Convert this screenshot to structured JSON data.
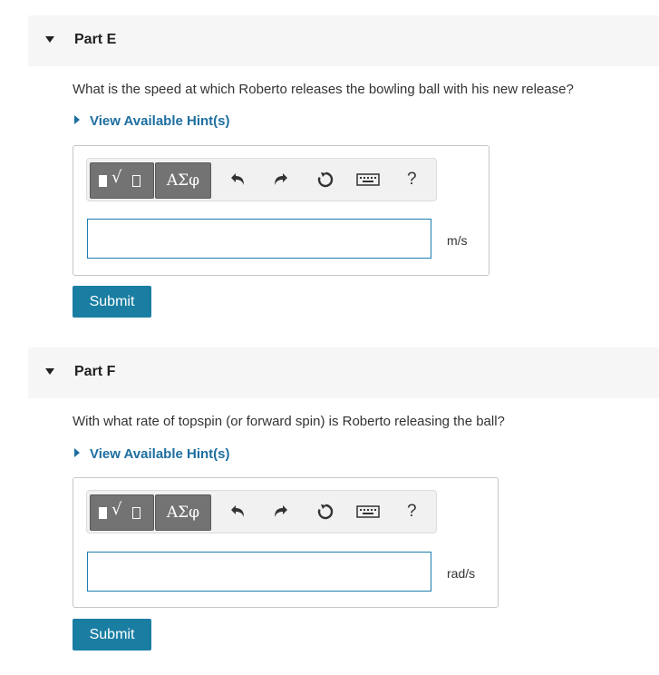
{
  "parts": [
    {
      "title": "Part E",
      "question": "What is the speed at which Roberto releases the bowling ball with his new release?",
      "hint_label": "View Available Hint(s)",
      "answer": {
        "value": "",
        "unit": "m/s"
      },
      "submit_label": "Submit"
    },
    {
      "title": "Part F",
      "question": "With what rate of topspin (or forward spin) is Roberto releasing the ball?",
      "hint_label": "View Available Hint(s)",
      "answer": {
        "value": "",
        "unit": "rad/s"
      },
      "submit_label": "Submit"
    }
  ],
  "toolbar": {
    "greek_label": "ΑΣφ",
    "help_label": "?",
    "icons": [
      "templates-icon",
      "undo-icon",
      "redo-icon",
      "reset-icon",
      "keyboard-icon",
      "help-icon"
    ]
  },
  "colors": {
    "accent": "#1a7ea2",
    "link": "#1d6fa0",
    "header_bg": "#f6f6f6",
    "tool_button": "#737373"
  }
}
